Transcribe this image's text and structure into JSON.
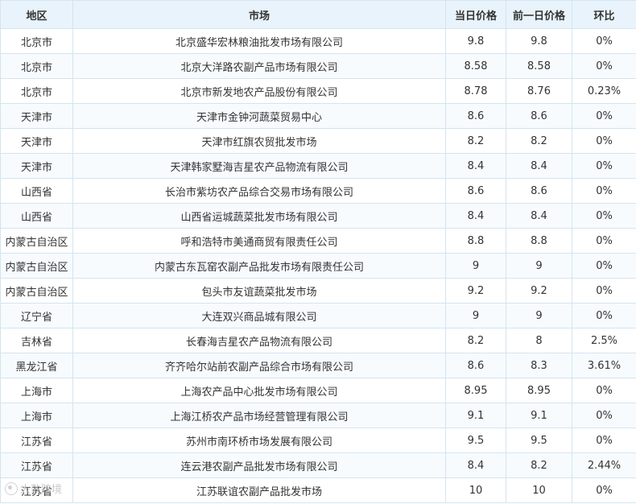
{
  "table": {
    "headers": {
      "region": "地区",
      "market": "市场",
      "today_price": "当日价格",
      "prev_price": "前一日价格",
      "change": "环比"
    },
    "rows": [
      {
        "region": "北京市",
        "market": "北京盛华宏林粮油批发市场有限公司",
        "today": "9.8",
        "prev": "9.8",
        "change": "0%"
      },
      {
        "region": "北京市",
        "market": "北京大洋路农副产品市场有限公司",
        "today": "8.58",
        "prev": "8.58",
        "change": "0%"
      },
      {
        "region": "北京市",
        "market": "北京市新发地农产品股份有限公司",
        "today": "8.78",
        "prev": "8.76",
        "change": "0.23%"
      },
      {
        "region": "天津市",
        "market": "天津市金钟河蔬菜贸易中心",
        "today": "8.6",
        "prev": "8.6",
        "change": "0%"
      },
      {
        "region": "天津市",
        "market": "天津市红旗农贸批发市场",
        "today": "8.2",
        "prev": "8.2",
        "change": "0%"
      },
      {
        "region": "天津市",
        "market": "天津韩家墅海吉星农产品物流有限公司",
        "today": "8.4",
        "prev": "8.4",
        "change": "0%"
      },
      {
        "region": "山西省",
        "market": "长治市紫坊农产品综合交易市场有限公司",
        "today": "8.6",
        "prev": "8.6",
        "change": "0%"
      },
      {
        "region": "山西省",
        "market": "山西省运城蔬菜批发市场有限公司",
        "today": "8.4",
        "prev": "8.4",
        "change": "0%"
      },
      {
        "region": "内蒙古自治区",
        "market": "呼和浩特市美通商贸有限责任公司",
        "today": "8.8",
        "prev": "8.8",
        "change": "0%"
      },
      {
        "region": "内蒙古自治区",
        "market": "内蒙古东瓦窑农副产品批发市场有限责任公司",
        "today": "9",
        "prev": "9",
        "change": "0%"
      },
      {
        "region": "内蒙古自治区",
        "market": "包头市友谊蔬菜批发市场",
        "today": "9.2",
        "prev": "9.2",
        "change": "0%"
      },
      {
        "region": "辽宁省",
        "market": "大连双兴商品城有限公司",
        "today": "9",
        "prev": "9",
        "change": "0%"
      },
      {
        "region": "吉林省",
        "market": "长春海吉星农产品物流有限公司",
        "today": "8.2",
        "prev": "8",
        "change": "2.5%"
      },
      {
        "region": "黑龙江省",
        "market": "齐齐哈尔站前农副产品综合市场有限公司",
        "today": "8.6",
        "prev": "8.3",
        "change": "3.61%"
      },
      {
        "region": "上海市",
        "market": "上海农产品中心批发市场有限公司",
        "today": "8.95",
        "prev": "8.95",
        "change": "0%"
      },
      {
        "region": "上海市",
        "market": "上海江桥农产品市场经营管理有限公司",
        "today": "9.1",
        "prev": "9.1",
        "change": "0%"
      },
      {
        "region": "江苏省",
        "market": "苏州市南环桥市场发展有限公司",
        "today": "9.5",
        "prev": "9.5",
        "change": "0%"
      },
      {
        "region": "江苏省",
        "market": "连云港农副产品批发市场有限公司",
        "today": "8.4",
        "prev": "8.2",
        "change": "2.44%"
      },
      {
        "region": "江苏省",
        "market": "江苏联谊农副产品批发市场",
        "today": "10",
        "prev": "10",
        "change": "0%"
      }
    ]
  },
  "watermark": {
    "text": "大数跨境",
    "icon": "brand-logo-icon"
  }
}
